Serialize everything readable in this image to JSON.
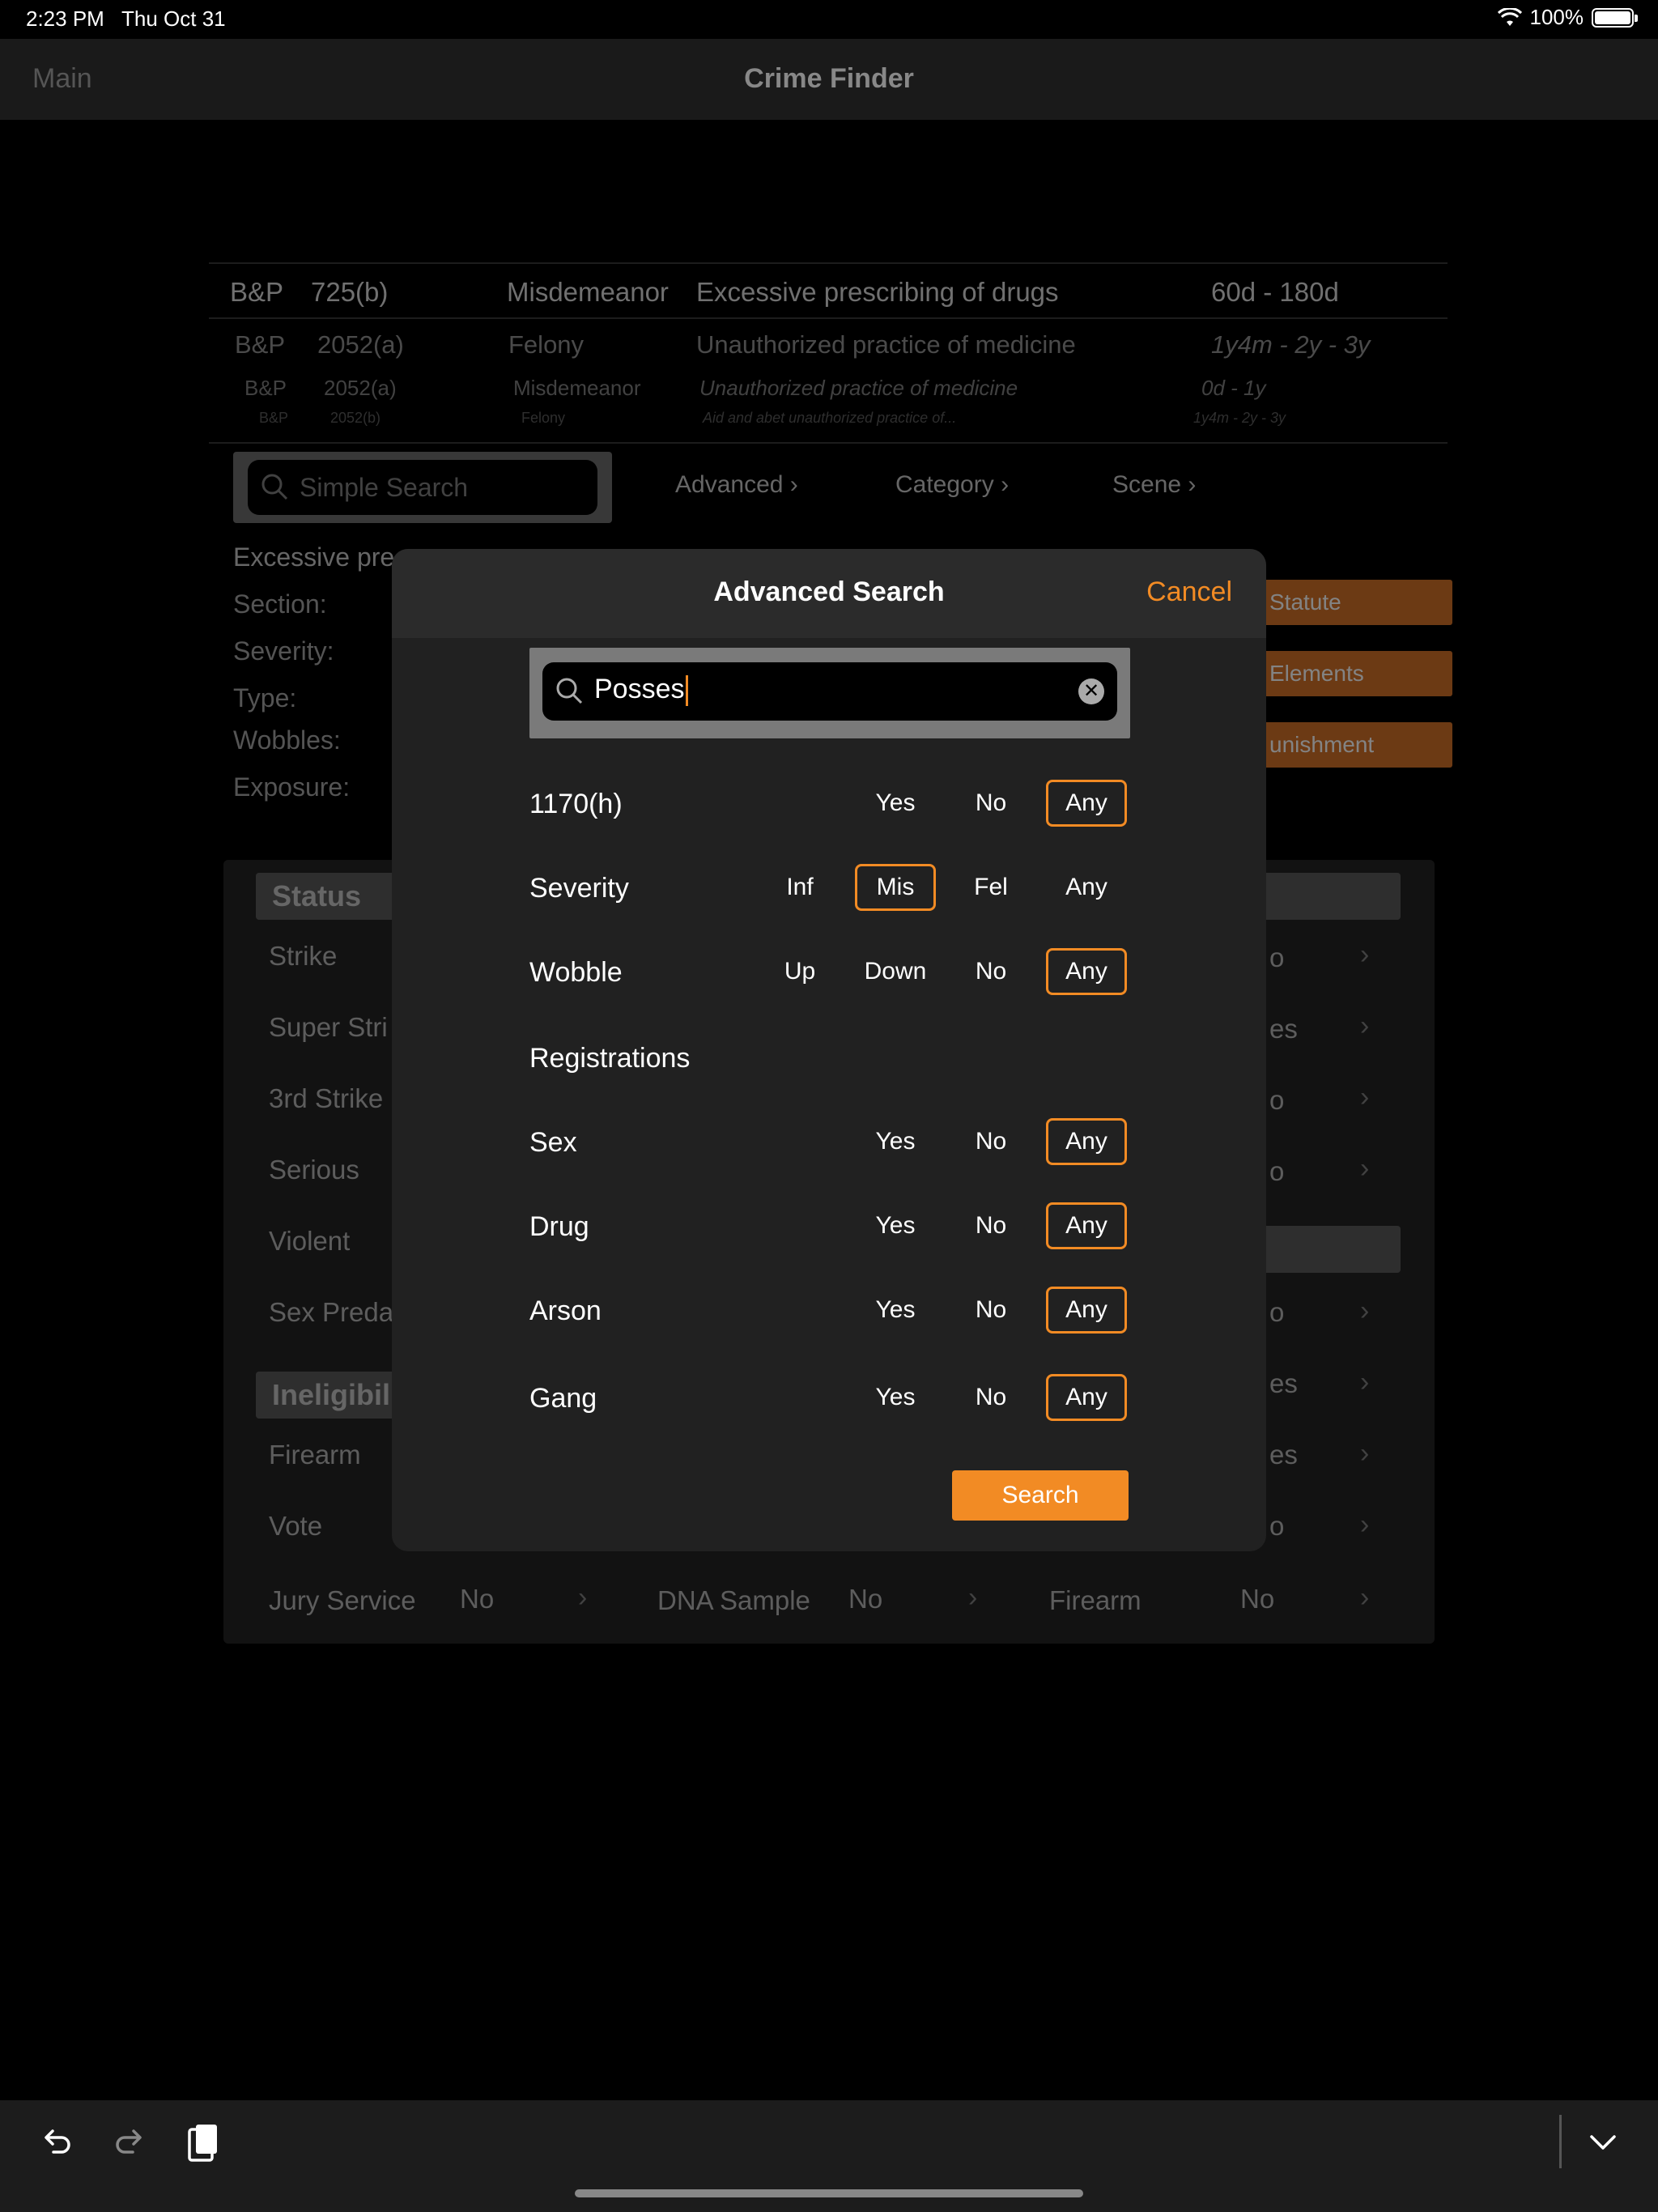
{
  "status_bar": {
    "time": "2:23 PM",
    "date": "Thu Oct 31",
    "battery": "100%"
  },
  "nav": {
    "back_label": "Main",
    "title": "Crime Finder"
  },
  "results_picker": [
    {
      "code": "B&P",
      "section": "725(b)",
      "severity": "Misdemeanor",
      "description": "Excessive prescribing of drugs",
      "sentence": "60d - 180d"
    },
    {
      "code": "B&P",
      "section": "2052(a)",
      "severity": "Felony",
      "description": "Unauthorized practice of medicine",
      "sentence": "1y4m - 2y - 3y"
    },
    {
      "code": "B&P",
      "section": "2052(a)",
      "severity": "Misdemeanor",
      "description": "Unauthorized practice of medicine",
      "sentence": "0d - 1y"
    },
    {
      "code": "B&P",
      "section": "2052(b)",
      "severity": "Felony",
      "description": "Aid and abet unauthorized practice of...",
      "sentence": "1y4m - 2y - 3y"
    }
  ],
  "search_bar": {
    "placeholder": "Simple Search",
    "links": [
      "Advanced",
      "Category",
      "Scene"
    ]
  },
  "detail": {
    "title": "Excessive pre",
    "labels": [
      "Section:",
      "Severity:",
      "Type:",
      "Wobbles:",
      "Exposure:"
    ],
    "buttons": [
      "Statute",
      "Elements",
      "unishment"
    ]
  },
  "status_panel": {
    "status_header": "Status",
    "status_rows": [
      "Strike",
      "Super Stri",
      "3rd Strike",
      "Serious",
      "Violent",
      "Sex Preda"
    ],
    "right_values": [
      "o",
      "es",
      "o",
      "o",
      "o",
      "es",
      "es",
      "o"
    ],
    "ineligible_header": "Ineligibil",
    "ineligible_rows": [
      "Firearm",
      "Vote"
    ],
    "bottom_row": [
      {
        "label": "Jury Service",
        "value": "No"
      },
      {
        "label": "DNA Sample",
        "value": "No"
      },
      {
        "label": "Firearm",
        "value": "No"
      }
    ]
  },
  "modal": {
    "title": "Advanced Search",
    "cancel": "Cancel",
    "search_value": "Posses",
    "rows": [
      {
        "label": "1170(h)",
        "options": [
          "Yes",
          "No",
          "Any"
        ],
        "selected": "Any"
      },
      {
        "label": "Severity",
        "options": [
          "Inf",
          "Mis",
          "Fel",
          "Any"
        ],
        "selected": "Mis"
      },
      {
        "label": "Wobble",
        "options": [
          "Up",
          "Down",
          "No",
          "Any"
        ],
        "selected": "Any"
      }
    ],
    "registrations_heading": "Registrations",
    "registrations": [
      {
        "label": "Sex",
        "options": [
          "Yes",
          "No",
          "Any"
        ],
        "selected": "Any"
      },
      {
        "label": "Drug",
        "options": [
          "Yes",
          "No",
          "Any"
        ],
        "selected": "Any"
      },
      {
        "label": "Arson",
        "options": [
          "Yes",
          "No",
          "Any"
        ],
        "selected": "Any"
      },
      {
        "label": "Gang",
        "options": [
          "Yes",
          "No",
          "Any"
        ],
        "selected": "Any"
      }
    ],
    "search_button": "Search"
  },
  "colors": {
    "accent": "#f28b24",
    "modal_bg": "#212121",
    "background": "#000000"
  }
}
